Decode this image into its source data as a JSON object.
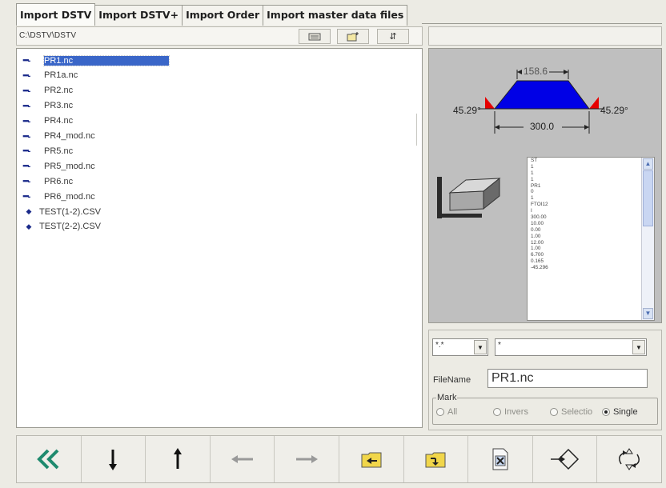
{
  "tabs": [
    "Import DSTV",
    "Import DSTV+",
    "Import Order",
    "Import master data files"
  ],
  "path": "C:\\DSTV\\DSTV",
  "toolbar_icons": [
    "folder-up-icon",
    "new-folder-icon",
    "refresh-icon"
  ],
  "files": [
    {
      "name": "PR1.nc",
      "type": "nc",
      "selected": true
    },
    {
      "name": "PR1a.nc",
      "type": "nc"
    },
    {
      "name": "PR2.nc",
      "type": "nc"
    },
    {
      "name": "PR3.nc",
      "type": "nc"
    },
    {
      "name": "PR4.nc",
      "type": "nc"
    },
    {
      "name": "PR4_mod.nc",
      "type": "nc"
    },
    {
      "name": "PR5.nc",
      "type": "nc"
    },
    {
      "name": "PR5_mod.nc",
      "type": "nc"
    },
    {
      "name": "PR6.nc",
      "type": "nc"
    },
    {
      "name": "PR6_mod.nc",
      "type": "nc"
    },
    {
      "name": "TEST(1-2).CSV",
      "type": "csv"
    },
    {
      "name": "TEST(2-2).CSV",
      "type": "csv"
    }
  ],
  "preview": {
    "top_dim": "158.6",
    "bottom_dim": "300.0",
    "left_angle": "45.29°",
    "right_angle": "45.29°",
    "colors": {
      "profile": "#0000e6",
      "bevel": "#e60000",
      "background": "#bfbfbf"
    },
    "data_lines": [
      "ST",
      "1",
      "1",
      "1",
      "PR1",
      "0",
      "1",
      "FTOI12",
      "I",
      "300.00",
      "10.00",
      "0.00",
      "1.00",
      "12.00",
      "1.00",
      "6.700",
      "0.165",
      "-45.296"
    ]
  },
  "filter": {
    "ext_value": "*.*",
    "name_value": "*"
  },
  "filename": {
    "label": "FileName",
    "value": "PR1.nc"
  },
  "mark": {
    "title": "Mark",
    "options": [
      {
        "label": "All",
        "selected": false,
        "enabled": false
      },
      {
        "label": "Invers",
        "selected": false,
        "enabled": false
      },
      {
        "label": "Selectio",
        "selected": false,
        "enabled": false
      },
      {
        "label": "Single",
        "selected": true,
        "enabled": true
      }
    ]
  },
  "bottom_buttons": [
    "back-double-chevron-icon",
    "arrow-down-icon",
    "arrow-up-icon",
    "arrow-left-icon",
    "arrow-right-icon",
    "import-folder-icon",
    "export-folder-icon",
    "delete-file-icon",
    "import-arrow-icon",
    "rotate-arrows-icon"
  ]
}
